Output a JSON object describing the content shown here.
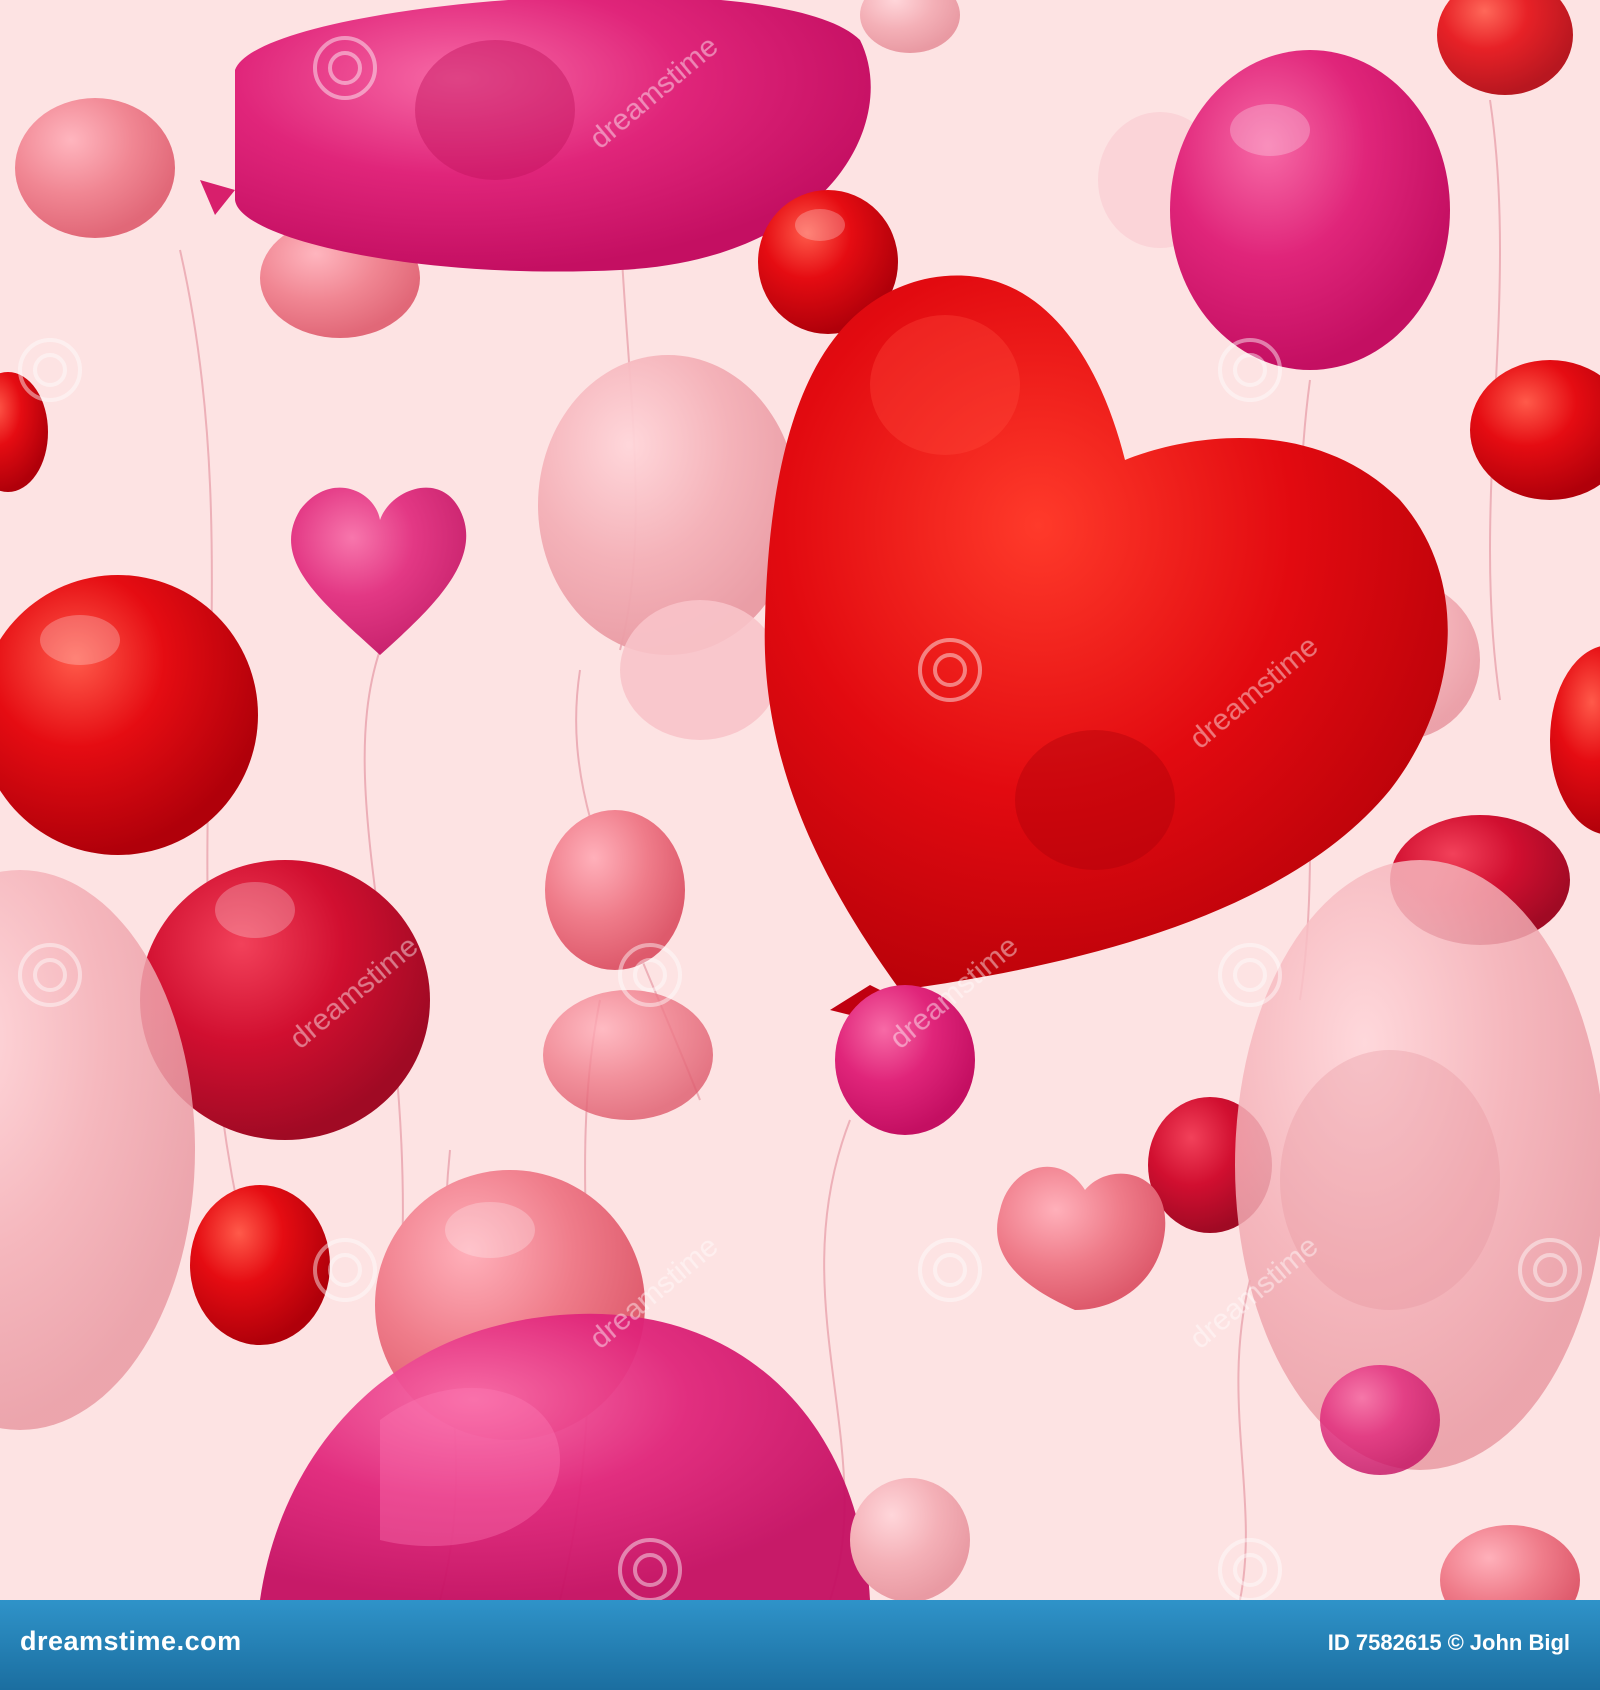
{
  "image": {
    "background_color": "#fde3e3",
    "subject": "balloons",
    "colors": {
      "red": "#e00d12",
      "crimson": "#c8102e",
      "magenta": "#e0257a",
      "pink": "#f07f97",
      "pale_pink": "#f5b4bc"
    },
    "watermark_text": "dreamstime"
  },
  "footer": {
    "brand": "dreamstime.com",
    "image_id_label": "ID 7582615",
    "copyright_symbol": "©",
    "author": "John Bigl",
    "bar_color": "#2080b8"
  }
}
